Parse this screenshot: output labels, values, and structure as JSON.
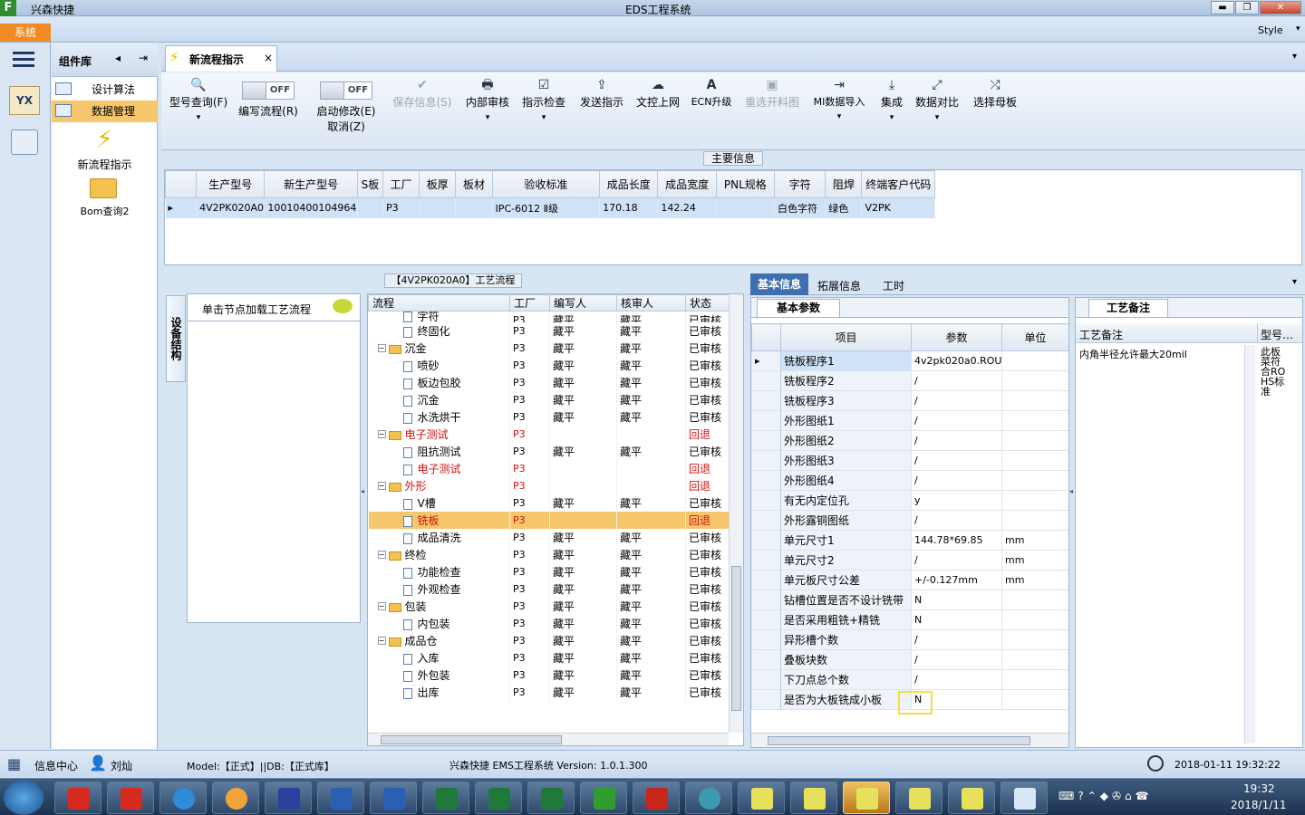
{
  "window": {
    "app_name": "兴森快捷",
    "title": "EDS工程系统",
    "style_label": "Style",
    "minimize": "▬",
    "restore": "❐",
    "close": "✕"
  },
  "menu": {
    "system": "系统"
  },
  "component_lib": {
    "title": "组件库",
    "items": [
      {
        "label": "设计算法"
      },
      {
        "label": "数据管理"
      }
    ],
    "tools": [
      {
        "label": "新流程指示"
      },
      {
        "label": "Bom查询2"
      }
    ]
  },
  "tab": {
    "label": "新流程指示",
    "close": "×"
  },
  "ribbon": {
    "buttons": [
      {
        "label": "型号查询(F)",
        "sub": "▾",
        "icon": "search-icon",
        "glyph": "🔍"
      },
      {
        "label": "编写流程(R)",
        "state": "OFF"
      },
      {
        "label": "启动修改(E)",
        "label2": "取消(Z)",
        "state": "OFF"
      },
      {
        "label": "保存信息(S)",
        "glyph": "✔"
      },
      {
        "label": "内部审核",
        "sub": "▾",
        "glyph": "🖶"
      },
      {
        "label": "指示检查",
        "sub": "▾",
        "glyph": "☑"
      },
      {
        "label": "发送指示",
        "glyph": "⇪"
      },
      {
        "label": "文控上网",
        "glyph": "☁"
      },
      {
        "label": "ECN升级",
        "glyph": "A"
      },
      {
        "label": "重选开料图",
        "glyph": "▣"
      },
      {
        "label": "MI数据导入",
        "sub": "▾",
        "glyph": "⇥"
      },
      {
        "label": "集成",
        "sub": "▾",
        "glyph": "⤓"
      },
      {
        "label": "数据对比",
        "sub": "▾",
        "glyph": "⤢"
      },
      {
        "label": "选择母板",
        "glyph": "⤮"
      }
    ]
  },
  "main_info": {
    "title": "主要信息",
    "columns": [
      "生产型号",
      "新生产型号",
      "S板",
      "工厂",
      "板厚",
      "板材",
      "验收标准",
      "成品长度",
      "成品宽度",
      "PNL规格",
      "字符",
      "阻焊",
      "终端客户代码"
    ],
    "rows": [
      [
        "4V2PK020A0",
        "10010400104964",
        "",
        "P3",
        "",
        "",
        "IPC-6012 Ⅱ级",
        "170.18",
        "142.24",
        "",
        "白色字符",
        "绿色",
        "V2PK"
      ]
    ]
  },
  "process": {
    "title": "【4V2PK020A0】工艺流程",
    "side_tab": "设备结构",
    "hint": "单击节点加载工艺流程",
    "columns": [
      "流程",
      "工厂",
      "编写人",
      "核审人",
      "状态"
    ],
    "rows": [
      {
        "name": "字符",
        "level": 2,
        "type": "doc",
        "factory": "P3",
        "writer": "藏平",
        "reviewer": "藏平",
        "status": "已审核",
        "red": false,
        "partial": true
      },
      {
        "name": "终固化",
        "level": 2,
        "type": "doc",
        "factory": "P3",
        "writer": "藏平",
        "reviewer": "藏平",
        "status": "已审核",
        "red": false
      },
      {
        "name": "沉金",
        "level": 1,
        "type": "folder",
        "factory": "P3",
        "writer": "藏平",
        "reviewer": "藏平",
        "status": "已审核",
        "red": false
      },
      {
        "name": "喷砂",
        "level": 2,
        "type": "doc",
        "factory": "P3",
        "writer": "藏平",
        "reviewer": "藏平",
        "status": "已审核",
        "red": false
      },
      {
        "name": "板边包胶",
        "level": 2,
        "type": "doc",
        "factory": "P3",
        "writer": "藏平",
        "reviewer": "藏平",
        "status": "已审核",
        "red": false
      },
      {
        "name": "沉金",
        "level": 2,
        "type": "doc",
        "factory": "P3",
        "writer": "藏平",
        "reviewer": "藏平",
        "status": "已审核",
        "red": false
      },
      {
        "name": "水洗烘干",
        "level": 2,
        "type": "doc",
        "factory": "P3",
        "writer": "藏平",
        "reviewer": "藏平",
        "status": "已审核",
        "red": false
      },
      {
        "name": "电子测试",
        "level": 1,
        "type": "folder",
        "factory": "P3",
        "writer": "",
        "reviewer": "",
        "status": "回退",
        "red": true
      },
      {
        "name": "阻抗测试",
        "level": 2,
        "type": "doc",
        "factory": "P3",
        "writer": "藏平",
        "reviewer": "藏平",
        "status": "已审核",
        "red": false
      },
      {
        "name": "电子测试",
        "level": 2,
        "type": "doc",
        "factory": "P3",
        "writer": "",
        "reviewer": "",
        "status": "回退",
        "red": true
      },
      {
        "name": "外形",
        "level": 1,
        "type": "folder",
        "factory": "P3",
        "writer": "",
        "reviewer": "",
        "status": "回退",
        "red": true
      },
      {
        "name": "V槽",
        "level": 2,
        "type": "doc",
        "factory": "P3",
        "writer": "藏平",
        "reviewer": "藏平",
        "status": "已审核",
        "red": false
      },
      {
        "name": "铣板",
        "level": 2,
        "type": "doc",
        "factory": "P3",
        "writer": "",
        "reviewer": "",
        "status": "回退",
        "red": true,
        "selected": true
      },
      {
        "name": "成品清洗",
        "level": 2,
        "type": "doc",
        "factory": "P3",
        "writer": "藏平",
        "reviewer": "藏平",
        "status": "已审核",
        "red": false
      },
      {
        "name": "终检",
        "level": 1,
        "type": "folder",
        "factory": "P3",
        "writer": "藏平",
        "reviewer": "藏平",
        "status": "已审核",
        "red": false
      },
      {
        "name": "功能检查",
        "level": 2,
        "type": "doc",
        "factory": "P3",
        "writer": "藏平",
        "reviewer": "藏平",
        "status": "已审核",
        "red": false
      },
      {
        "name": "外观检查",
        "level": 2,
        "type": "doc",
        "factory": "P3",
        "writer": "藏平",
        "reviewer": "藏平",
        "status": "已审核",
        "red": false
      },
      {
        "name": "包装",
        "level": 1,
        "type": "folder",
        "factory": "P3",
        "writer": "藏平",
        "reviewer": "藏平",
        "status": "已审核",
        "red": false
      },
      {
        "name": "内包装",
        "level": 2,
        "type": "doc",
        "factory": "P3",
        "writer": "藏平",
        "reviewer": "藏平",
        "status": "已审核",
        "red": false
      },
      {
        "name": "成品仓",
        "level": 1,
        "type": "folder",
        "factory": "P3",
        "writer": "藏平",
        "reviewer": "藏平",
        "status": "已审核",
        "red": false
      },
      {
        "name": "入库",
        "level": 2,
        "type": "doc",
        "factory": "P3",
        "writer": "藏平",
        "reviewer": "藏平",
        "status": "已审核",
        "red": false
      },
      {
        "name": "外包装",
        "level": 2,
        "type": "doc",
        "factory": "P3",
        "writer": "藏平",
        "reviewer": "藏平",
        "status": "已审核",
        "red": false
      },
      {
        "name": "出库",
        "level": 2,
        "type": "doc",
        "factory": "P3",
        "writer": "藏平",
        "reviewer": "藏平",
        "status": "已审核",
        "red": false
      }
    ]
  },
  "right_tabs": [
    "基本信息",
    "拓展信息",
    "工时"
  ],
  "basic_params": {
    "tab": "基本参数",
    "columns": [
      "项目",
      "参数",
      "单位"
    ],
    "rows": [
      [
        "铣板程序1",
        "4v2pk020a0.ROU",
        ""
      ],
      [
        "铣板程序2",
        "/",
        ""
      ],
      [
        "铣板程序3",
        "/",
        ""
      ],
      [
        "外形图纸1",
        "/",
        ""
      ],
      [
        "外形图纸2",
        "/",
        ""
      ],
      [
        "外形图纸3",
        "/",
        ""
      ],
      [
        "外形图纸4",
        "/",
        ""
      ],
      [
        "有无内定位孔",
        "y",
        ""
      ],
      [
        "外形露铜图纸",
        "/",
        ""
      ],
      [
        "单元尺寸1",
        "144.78*69.85",
        "mm"
      ],
      [
        "单元尺寸2",
        "/",
        "mm"
      ],
      [
        "单元板尺寸公差",
        "+/-0.127mm",
        "mm"
      ],
      [
        "钻槽位置是否不设计铣带",
        "N",
        ""
      ],
      [
        "是否采用粗铣+精铣",
        "N",
        ""
      ],
      [
        "异形槽个数",
        "/",
        ""
      ],
      [
        "叠板块数",
        "/",
        ""
      ],
      [
        "下刀点总个数",
        "/",
        ""
      ],
      [
        "是否为大板铣成小板",
        "N",
        ""
      ]
    ]
  },
  "process_note": {
    "tab": "工艺备注",
    "columns": [
      "工艺备注",
      "型号…"
    ],
    "note": "内角半径允许最大20mil",
    "model_text": "此板菜符合ROHS标准"
  },
  "status": {
    "info_center": "信息中心",
    "user": "刘灿",
    "model_db": "Model:【正式】||DB:【正式库】",
    "version": "兴森快捷 EMS工程系统 Version: 1.0.1.300",
    "datetime": "2018-01-11 19:32:22"
  },
  "taskbar": {
    "time": "19:32",
    "date": "2018/1/11"
  }
}
